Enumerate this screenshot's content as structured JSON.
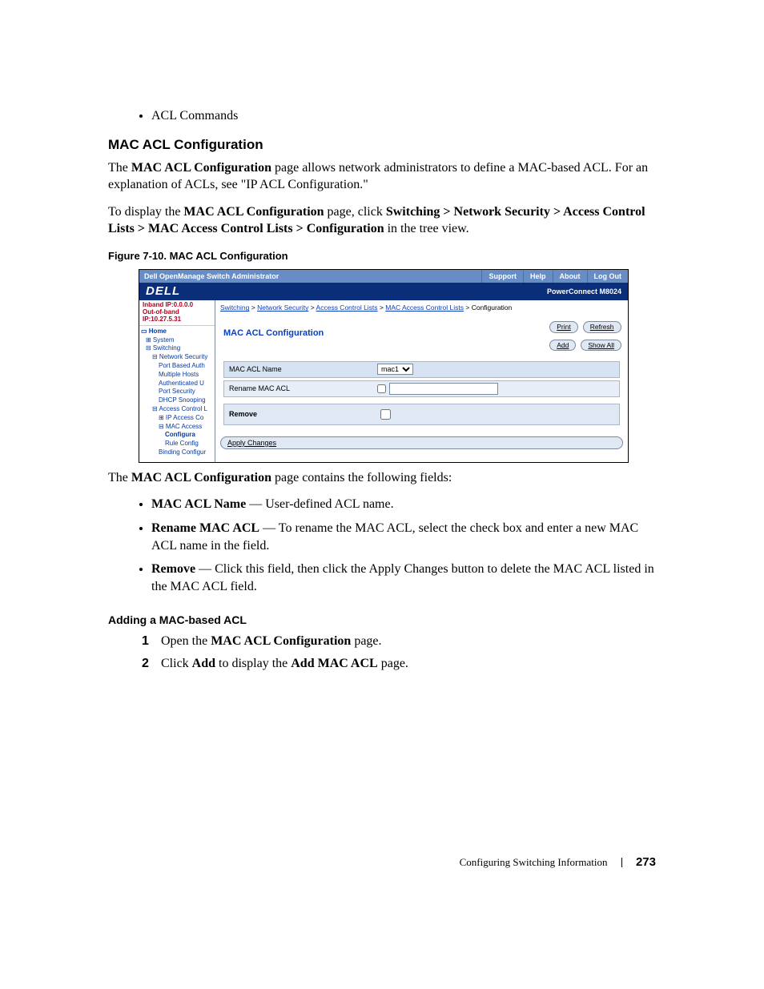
{
  "top_bullet": "ACL Commands",
  "heading_mac_acl": "MAC ACL Configuration",
  "para1_pre": "The ",
  "para1_bold": "MAC ACL Configuration",
  "para1_post": " page allows network administrators to define a MAC-based ACL. For an explanation of ACLs, see \"IP ACL Configuration.\"",
  "para2_pre": "To display the ",
  "para2_bold1": "MAC ACL Configuration",
  "para2_mid": " page, click ",
  "para2_bold2": "Switching > Network Security > Access Control Lists > MAC Access Control Lists > Configuration",
  "para2_post": " in the tree view.",
  "fig_caption": "Figure 7-10.    MAC ACL Configuration",
  "shot": {
    "topbar_title": "Dell OpenManage Switch Administrator",
    "topbar_buttons": [
      "Support",
      "Help",
      "About",
      "Log Out"
    ],
    "brand": "DELL",
    "product": "PowerConnect M8024",
    "ip_line1": "Inband IP:0.0.0.0",
    "ip_line2": "Out-of-band IP:10.27.5.31",
    "tree": [
      {
        "cls": "lvl0",
        "text": "▭ Home"
      },
      {
        "cls": "lvl1",
        "text": "⊞ System"
      },
      {
        "cls": "lvl1",
        "text": "⊟ Switching"
      },
      {
        "cls": "lvl2",
        "text": "⊟ Network Security"
      },
      {
        "cls": "lvl3",
        "text": "Port Based Auth"
      },
      {
        "cls": "lvl3",
        "text": "Multiple Hosts"
      },
      {
        "cls": "lvl3",
        "text": "Authenticated U"
      },
      {
        "cls": "lvl3",
        "text": "Port Security"
      },
      {
        "cls": "lvl3",
        "text": "DHCP Snooping"
      },
      {
        "cls": "lvl2",
        "text": "⊟ Access Control L"
      },
      {
        "cls": "lvl3",
        "text": "⊞ IP Access Co"
      },
      {
        "cls": "lvl3",
        "text": "⊟ MAC Access"
      },
      {
        "cls": "lvl4 sel",
        "text": "Configura"
      },
      {
        "cls": "lvl4",
        "text": "Rule Config"
      },
      {
        "cls": "lvl3",
        "text": "Binding Configur"
      }
    ],
    "bc": {
      "links": [
        "Switching",
        "Network Security",
        "Access Control Lists",
        "MAC Access Control Lists"
      ],
      "tail": "Configuration"
    },
    "panel_title": "MAC ACL Configuration",
    "btn_print": "Print",
    "btn_refresh": "Refresh",
    "btn_add": "Add",
    "btn_showall": "Show All",
    "row_name_label": "MAC ACL Name",
    "row_name_value": "mac1",
    "row_rename_label": "Rename MAC ACL",
    "row_remove_label": "Remove",
    "btn_apply": "Apply Changes"
  },
  "para3_pre": "The ",
  "para3_bold": "MAC ACL Configuration",
  "para3_post": " page contains the following fields:",
  "fields": [
    {
      "term": "MAC ACL Name",
      "text": " — User-defined ACL name."
    },
    {
      "term": "Rename MAC ACL",
      "text": " — To rename the MAC ACL, select the check box and enter a new MAC ACL name in the field."
    },
    {
      "term": "Remove",
      "text": " — Click this field, then click the Apply Changes button to delete the MAC ACL listed in the MAC ACL field."
    }
  ],
  "heading_add": "Adding a MAC-based ACL",
  "step1_pre": "Open the ",
  "step1_bold": "MAC ACL Configuration",
  "step1_post": " page.",
  "step2_pre": "Click ",
  "step2_bold1": "Add",
  "step2_mid": " to display the ",
  "step2_bold2": "Add MAC ACL",
  "step2_post": " page.",
  "footer_text": "Configuring Switching Information",
  "footer_page": "273"
}
